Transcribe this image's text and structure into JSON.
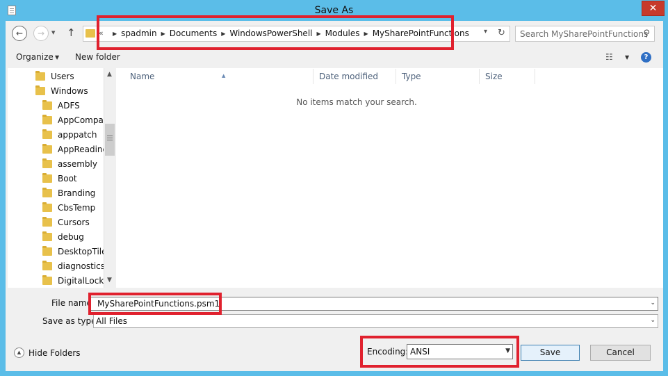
{
  "window": {
    "title": "Save As",
    "close_label": "✕"
  },
  "nav": {
    "back_icon": "back-arrow-icon",
    "forward_icon": "forward-arrow-icon",
    "up_icon": "up-arrow-icon"
  },
  "address": {
    "overflow": "«",
    "crumbs": [
      "spadmin",
      "Documents",
      "WindowsPowerShell",
      "Modules",
      "MySharePointFunctions"
    ]
  },
  "search": {
    "placeholder": "Search MySharePointFunctions"
  },
  "toolbar": {
    "organize_label": "Organize",
    "new_folder_label": "New folder"
  },
  "tree": {
    "items": [
      {
        "label": "Users",
        "level": 0
      },
      {
        "label": "Windows",
        "level": 0
      },
      {
        "label": "ADFS",
        "level": 1
      },
      {
        "label": "AppCompat",
        "level": 1
      },
      {
        "label": "apppatch",
        "level": 1
      },
      {
        "label": "AppReadiness",
        "level": 1
      },
      {
        "label": "assembly",
        "level": 1
      },
      {
        "label": "Boot",
        "level": 1
      },
      {
        "label": "Branding",
        "level": 1
      },
      {
        "label": "CbsTemp",
        "level": 1
      },
      {
        "label": "Cursors",
        "level": 1
      },
      {
        "label": "debug",
        "level": 1
      },
      {
        "label": "DesktopTileResources",
        "level": 1
      },
      {
        "label": "diagnostics",
        "level": 1
      },
      {
        "label": "DigitalLocker",
        "level": 1
      }
    ]
  },
  "filelist": {
    "columns": {
      "name": "Name",
      "date": "Date modified",
      "type": "Type",
      "size": "Size"
    },
    "empty_message": "No items match your search."
  },
  "form": {
    "filename_label": "File name:",
    "filename_value": "MySharePointFunctions.psm1",
    "savetype_label": "Save as type:",
    "savetype_value": "All Files",
    "encoding_label": "Encoding:",
    "encoding_value": "ANSI",
    "hide_folders_label": "Hide Folders",
    "save_label": "Save",
    "cancel_label": "Cancel"
  },
  "colors": {
    "window_frame": "#5bbde8",
    "highlight": "#e0212e",
    "folder": "#e8c14b"
  }
}
